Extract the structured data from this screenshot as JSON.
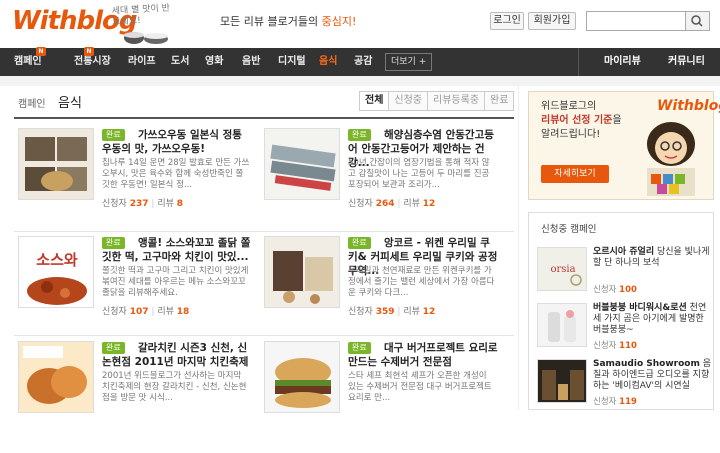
{
  "header": {
    "logo": "Withblog",
    "slogan": "세대 별 맛이 반드세요!",
    "tagline_prefix": "모든 리뷰 블로거들의 ",
    "tagline_highlight": "중심지!",
    "login": "로그인",
    "signup": "회원가입",
    "search_placeholder": ""
  },
  "nav": {
    "items": [
      "캠페인",
      "전통시장",
      "라이프",
      "도서",
      "영화",
      "음반",
      "디지털",
      "음식",
      "공감"
    ],
    "active": "음식",
    "more": "더보기 +",
    "right": [
      "마이리뷰",
      "커뮤니티"
    ],
    "new_badge": "N"
  },
  "page": {
    "breadcrumb": "캠페인",
    "title": "음식",
    "filters": [
      "전체",
      "신청중",
      "리뷰등록중",
      "완료"
    ]
  },
  "stat_labels": {
    "applicants": "신청자",
    "reviews": "리뷰"
  },
  "cards": [
    {
      "badge": "완료",
      "title": "가쓰오우동 일본식 정통 우동의 맛, 가쓰오우동!",
      "desc": "칩나루 14일 운면 28일 발효로 만든 가쓰오부시, 맛은 육수와 함께 숙성반죽인 쫄깃한 우동면! 일본식 정...",
      "applicants": "237",
      "reviews": "8"
    },
    {
      "badge": "완료",
      "title": "해양심층수염 안동간고등어 안동간고등어가 제안하는 건강...",
      "desc": "50년 간잡이의 염장기법을 통해 적자 않고 감칠맛이 나는 고등어 두 마리를 진공 포장되어 보관과 조리가...",
      "applicants": "264",
      "reviews": "12"
    },
    {
      "badge": "완료",
      "title": "앵콜! 소스와꼬꼬 졸닭 쫄깃한 떡, 고구마와 치킨이 맛있...",
      "desc": "쫄깃한 떡과 고구마 그리고 치킨이 맛있게 볶여진 세대를 아우르는 메뉴 소스와꼬꼬 졸닭을 리뷰해주세요.",
      "applicants": "107",
      "reviews": "18"
    },
    {
      "badge": "완료",
      "title": "앙코르 - 위켄 우리밀 쿠키& 커피세트 우리밀 쿠키와 공정무역...",
      "desc": "우리밀과 천연재료로 만든 위켄쿠키를 가정에서 즐기는 밸런 세상에서 가장 아름다운 쿠키와 다크...",
      "applicants": "359",
      "reviews": "12"
    },
    {
      "badge": "완료",
      "title": "갈라치킨 시즌3 신천, 신논현점 2011년 마지막 치킨축제",
      "desc": "2001년 위드블로그가 선사하는 마지막 치킨축제의 현장 갈라치킨 - 신천, 신논현점을 방문 맛 시식...",
      "applicants": "",
      "reviews": ""
    },
    {
      "badge": "완료",
      "title": "대구 버거프로젝트 요리로 만드는 수제버거 전문점",
      "desc": "스타 셰프 최현석 셰프가 오픈한 개성이 있는 수제버거 전문점 대구 버거프로젝트 요리로 만...",
      "applicants": "",
      "reviews": ""
    }
  ],
  "promo": {
    "logo": "Withblog",
    "line1": "위드블로그의",
    "line2_highlight": "리뷰어 선정 기준",
    "line2_rest": "을",
    "line3": "알려드립니다!",
    "button": "자세히보기"
  },
  "sidebar": {
    "title": "신청중 캠페인",
    "items": [
      {
        "name": "오르시아 쥬얼리",
        "desc": " 당신을 빛나게 할 단 하나의 보석",
        "applicants": "100"
      },
      {
        "name": "버블붕붕 바디워시&로션",
        "desc": " 천연 세 가지 곰은 아기에게 발명한 버블붕붕~",
        "applicants": "110"
      },
      {
        "name": "Samaudio Showroom",
        "desc": " 음질과 하이엔드급 오디오를 지향하는 '베이컴AV'의 시연실",
        "applicants": "119"
      }
    ]
  },
  "colors": {
    "accent": "#e8580c",
    "nav_bg": "#333333",
    "badge": "#7bb52a"
  }
}
